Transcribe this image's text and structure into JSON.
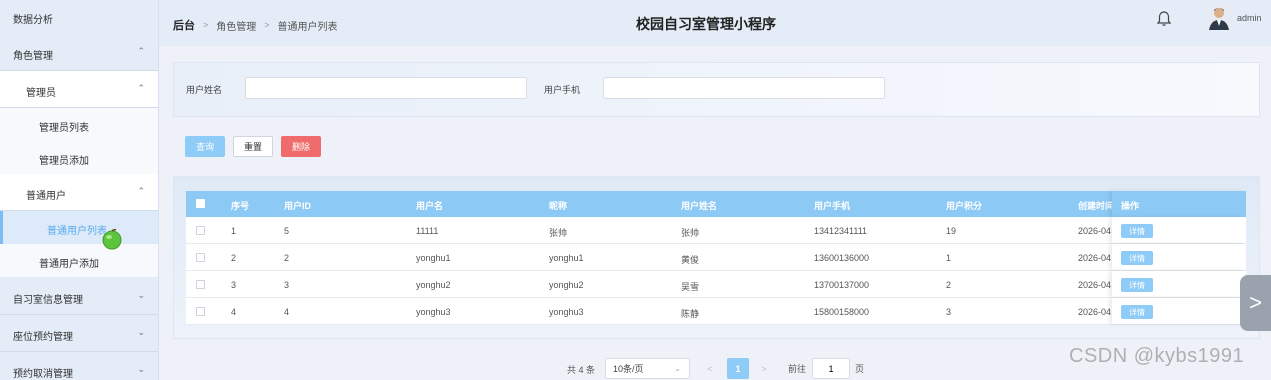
{
  "sidebar": {
    "items": [
      {
        "label": "数据分析",
        "chevron": ""
      },
      {
        "label": "角色管理",
        "chevron": "^"
      },
      {
        "label": "管理员",
        "chevron": "^"
      },
      {
        "label": "管理员列表"
      },
      {
        "label": "管理员添加"
      },
      {
        "label": "普通用户",
        "chevron": "^"
      },
      {
        "label": "普通用户列表"
      },
      {
        "label": "普通用户添加"
      },
      {
        "label": "自习室信息管理",
        "chevron": "v"
      },
      {
        "label": "座位预约管理",
        "chevron": "v"
      },
      {
        "label": "预约取消管理",
        "chevron": "v"
      }
    ]
  },
  "header": {
    "breadcrumb": [
      "后台",
      "角色管理",
      "普通用户列表"
    ],
    "title": "校园自习室管理小程序",
    "user": "admin",
    "icons": {
      "bell": "bell-icon",
      "separator": "chevron-right-icon"
    }
  },
  "search": {
    "name_label": "用户姓名",
    "name_value": "",
    "phone_label": "用户手机",
    "phone_value": ""
  },
  "actions": {
    "query": "查询",
    "reset": "重置",
    "delete": "删除"
  },
  "table": {
    "columns": [
      "序号",
      "用户ID",
      "用户名",
      "昵称",
      "用户姓名",
      "用户手机",
      "用户积分",
      "创建时间",
      "操作"
    ],
    "rows": [
      {
        "index": "1",
        "id": "5",
        "username": "11111",
        "nickname": "张帅",
        "realname": "张帅",
        "phone": "13412341111",
        "points": "19",
        "created": "2026-04",
        "op": "详情"
      },
      {
        "index": "2",
        "id": "2",
        "username": "yonghu1",
        "nickname": "yonghu1",
        "realname": "黄俊",
        "phone": "13600136000",
        "points": "1",
        "created": "2026-04",
        "op": "详情"
      },
      {
        "index": "3",
        "id": "3",
        "username": "yonghu2",
        "nickname": "yonghu2",
        "realname": "吴雪",
        "phone": "13700137000",
        "points": "2",
        "created": "2026-04",
        "op": "详情"
      },
      {
        "index": "4",
        "id": "4",
        "username": "yonghu3",
        "nickname": "yonghu3",
        "realname": "陈静",
        "phone": "15800158000",
        "points": "3",
        "created": "2026-04",
        "op": "详情"
      }
    ]
  },
  "pagination": {
    "total": "共 4 条",
    "page_size": "10条/页",
    "prev": "<",
    "current": "1",
    "next": ">",
    "goto_label": "前往",
    "goto_value": "1",
    "page_suffix": "页"
  },
  "float_next": ">",
  "watermark": "CSDN @kybs1991",
  "colors": {
    "accent": "#8ecbf7",
    "danger": "#f06c6c",
    "sidebar_bg": "#e3ecf7",
    "active_text": "#5aa9ec"
  }
}
